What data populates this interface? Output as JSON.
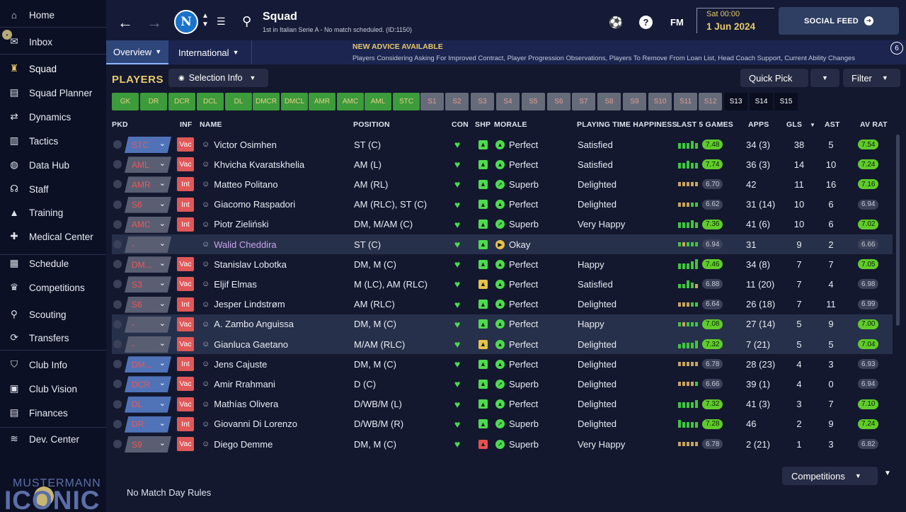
{
  "sidebar": {
    "items": [
      "Home",
      "Inbox",
      "Squad",
      "Squad Planner",
      "Dynamics",
      "Tactics",
      "Data Hub",
      "Staff",
      "Training",
      "Medical Center",
      "Schedule",
      "Competitions",
      "Scouting",
      "Transfers",
      "Club Info",
      "Club Vision",
      "Finances",
      "Dev. Center"
    ],
    "logo_top": "MUSTERMANN",
    "logo_bottom": "ICONIC"
  },
  "header": {
    "title": "Squad",
    "subtitle": "1st in Italian Serie A - No match scheduled. (ID:1150)",
    "club_initial": "N",
    "fm_label": "FM",
    "date_time": "Sat 00:00",
    "date": "1 Jun 2024",
    "social_feed": "SOCIAL FEED"
  },
  "tabs": [
    "Overview",
    "International"
  ],
  "advice": {
    "title": "NEW ADVICE AVAILABLE",
    "text": "Players Considering Asking For Improved Contract, Player Progression Observations, Players To Remove From Loan List, Head Coach Support, Current Ability Changes",
    "count": "6"
  },
  "content": {
    "players_label": "PLAYERS",
    "selection_info": "Selection Info",
    "quick_pick": "Quick Pick",
    "filter": "Filter",
    "competitions": "Competitions",
    "footer": "No Match Day Rules"
  },
  "slots": [
    "GK",
    "DR",
    "DCR",
    "DCL",
    "DL",
    "DMCR",
    "DMCL",
    "AMR",
    "AMC",
    "AML",
    "STC",
    "S1",
    "S2",
    "S3",
    "S4",
    "S5",
    "S6",
    "S7",
    "S8",
    "S9",
    "S10",
    "S11",
    "S12",
    "S13",
    "S14",
    "S15"
  ],
  "columns": [
    "PKD",
    "INF",
    "NAME",
    "POSITION",
    "CON",
    "SHP",
    "MORALE",
    "PLAYING TIME HAPPINESS",
    "LAST 5 GAMES",
    "APPS",
    "GLS",
    "AST",
    "AV RAT"
  ],
  "players": [
    {
      "pkd": "STC",
      "inf": "Vac",
      "name": "Victor Osimhen",
      "position": "ST (C)",
      "morale": "Perfect",
      "pth": "Satisfied",
      "l5": "7.48",
      "apps": "34 (3)",
      "gls": "38",
      "ast": "5",
      "avrat": "7.54"
    },
    {
      "pkd": "AML",
      "inf": "Vac",
      "name": "Khvicha Kvaratskhelia",
      "position": "AM (L)",
      "morale": "Perfect",
      "pth": "Satisfied",
      "l5": "7.74",
      "apps": "36 (3)",
      "gls": "14",
      "ast": "10",
      "avrat": "7.24"
    },
    {
      "pkd": "AMR",
      "inf": "Int",
      "name": "Matteo Politano",
      "position": "AM (RL)",
      "morale": "Superb",
      "pth": "Delighted",
      "l5": "6.70",
      "apps": "42",
      "gls": "11",
      "ast": "16",
      "avrat": "7.16"
    },
    {
      "pkd": "S6",
      "inf": "Int",
      "name": "Giacomo Raspadori",
      "position": "AM (RLC), ST (C)",
      "morale": "Perfect",
      "pth": "Delighted",
      "l5": "6.62",
      "apps": "31 (14)",
      "gls": "10",
      "ast": "6",
      "avrat": "6.94"
    },
    {
      "pkd": "AMC",
      "inf": "Int",
      "name": "Piotr Zieliński",
      "position": "DM, M/AM (C)",
      "morale": "Superb",
      "pth": "Very Happy",
      "l5": "7.36",
      "apps": "41 (6)",
      "gls": "10",
      "ast": "6",
      "avrat": "7.02"
    },
    {
      "pkd": "-",
      "inf": "",
      "name": "Walid Cheddira",
      "position": "ST (C)",
      "morale": "Okay",
      "pth": "",
      "l5": "6.94",
      "apps": "31",
      "gls": "9",
      "ast": "2",
      "avrat": "6.66"
    },
    {
      "pkd": "DM...",
      "inf": "Vac",
      "name": "Stanislav Lobotka",
      "position": "DM, M (C)",
      "morale": "Perfect",
      "pth": "Happy",
      "l5": "7.46",
      "apps": "34 (8)",
      "gls": "7",
      "ast": "7",
      "avrat": "7.05"
    },
    {
      "pkd": "S3",
      "inf": "Vac",
      "name": "Eljif Elmas",
      "position": "M (LC), AM (RLC)",
      "morale": "Perfect",
      "pth": "Satisfied",
      "l5": "6.88",
      "apps": "11 (20)",
      "gls": "7",
      "ast": "4",
      "avrat": "6.98"
    },
    {
      "pkd": "S6",
      "inf": "Int",
      "name": "Jesper Lindstrøm",
      "position": "AM (RLC)",
      "morale": "Perfect",
      "pth": "Delighted",
      "l5": "6.64",
      "apps": "26 (18)",
      "gls": "7",
      "ast": "11",
      "avrat": "6.99"
    },
    {
      "pkd": "-",
      "inf": "Vac",
      "name": "A. Zambo Anguissa",
      "position": "DM, M (C)",
      "morale": "Perfect",
      "pth": "Happy",
      "l5": "7.08",
      "apps": "27 (14)",
      "gls": "5",
      "ast": "9",
      "avrat": "7.00"
    },
    {
      "pkd": "-",
      "inf": "Vac",
      "name": "Gianluca Gaetano",
      "position": "M/AM (RLC)",
      "morale": "Perfect",
      "pth": "Delighted",
      "l5": "7.32",
      "apps": "7 (21)",
      "gls": "5",
      "ast": "5",
      "avrat": "7.04"
    },
    {
      "pkd": "DM...",
      "inf": "Int",
      "name": "Jens Cajuste",
      "position": "DM, M (C)",
      "morale": "Perfect",
      "pth": "Delighted",
      "l5": "6.78",
      "apps": "28 (23)",
      "gls": "4",
      "ast": "3",
      "avrat": "6.93"
    },
    {
      "pkd": "DCR",
      "inf": "Vac",
      "name": "Amir Rrahmani",
      "position": "D (C)",
      "morale": "Superb",
      "pth": "Delighted",
      "l5": "6.66",
      "apps": "39 (1)",
      "gls": "4",
      "ast": "0",
      "avrat": "6.94"
    },
    {
      "pkd": "DL",
      "inf": "Vac",
      "name": "Mathías Olivera",
      "position": "D/WB/M (L)",
      "morale": "Perfect",
      "pth": "Delighted",
      "l5": "7.32",
      "apps": "41 (3)",
      "gls": "3",
      "ast": "7",
      "avrat": "7.10"
    },
    {
      "pkd": "DR",
      "inf": "Int",
      "name": "Giovanni Di Lorenzo",
      "position": "D/WB/M (R)",
      "morale": "Superb",
      "pth": "Delighted",
      "l5": "7.28",
      "apps": "46",
      "gls": "2",
      "ast": "9",
      "avrat": "7.24"
    },
    {
      "pkd": "S9",
      "inf": "Vac",
      "name": "Diego Demme",
      "position": "DM, M (C)",
      "morale": "Superb",
      "pth": "Very Happy",
      "l5": "6.78",
      "apps": "2 (21)",
      "gls": "1",
      "ast": "3",
      "avrat": "6.82"
    }
  ]
}
